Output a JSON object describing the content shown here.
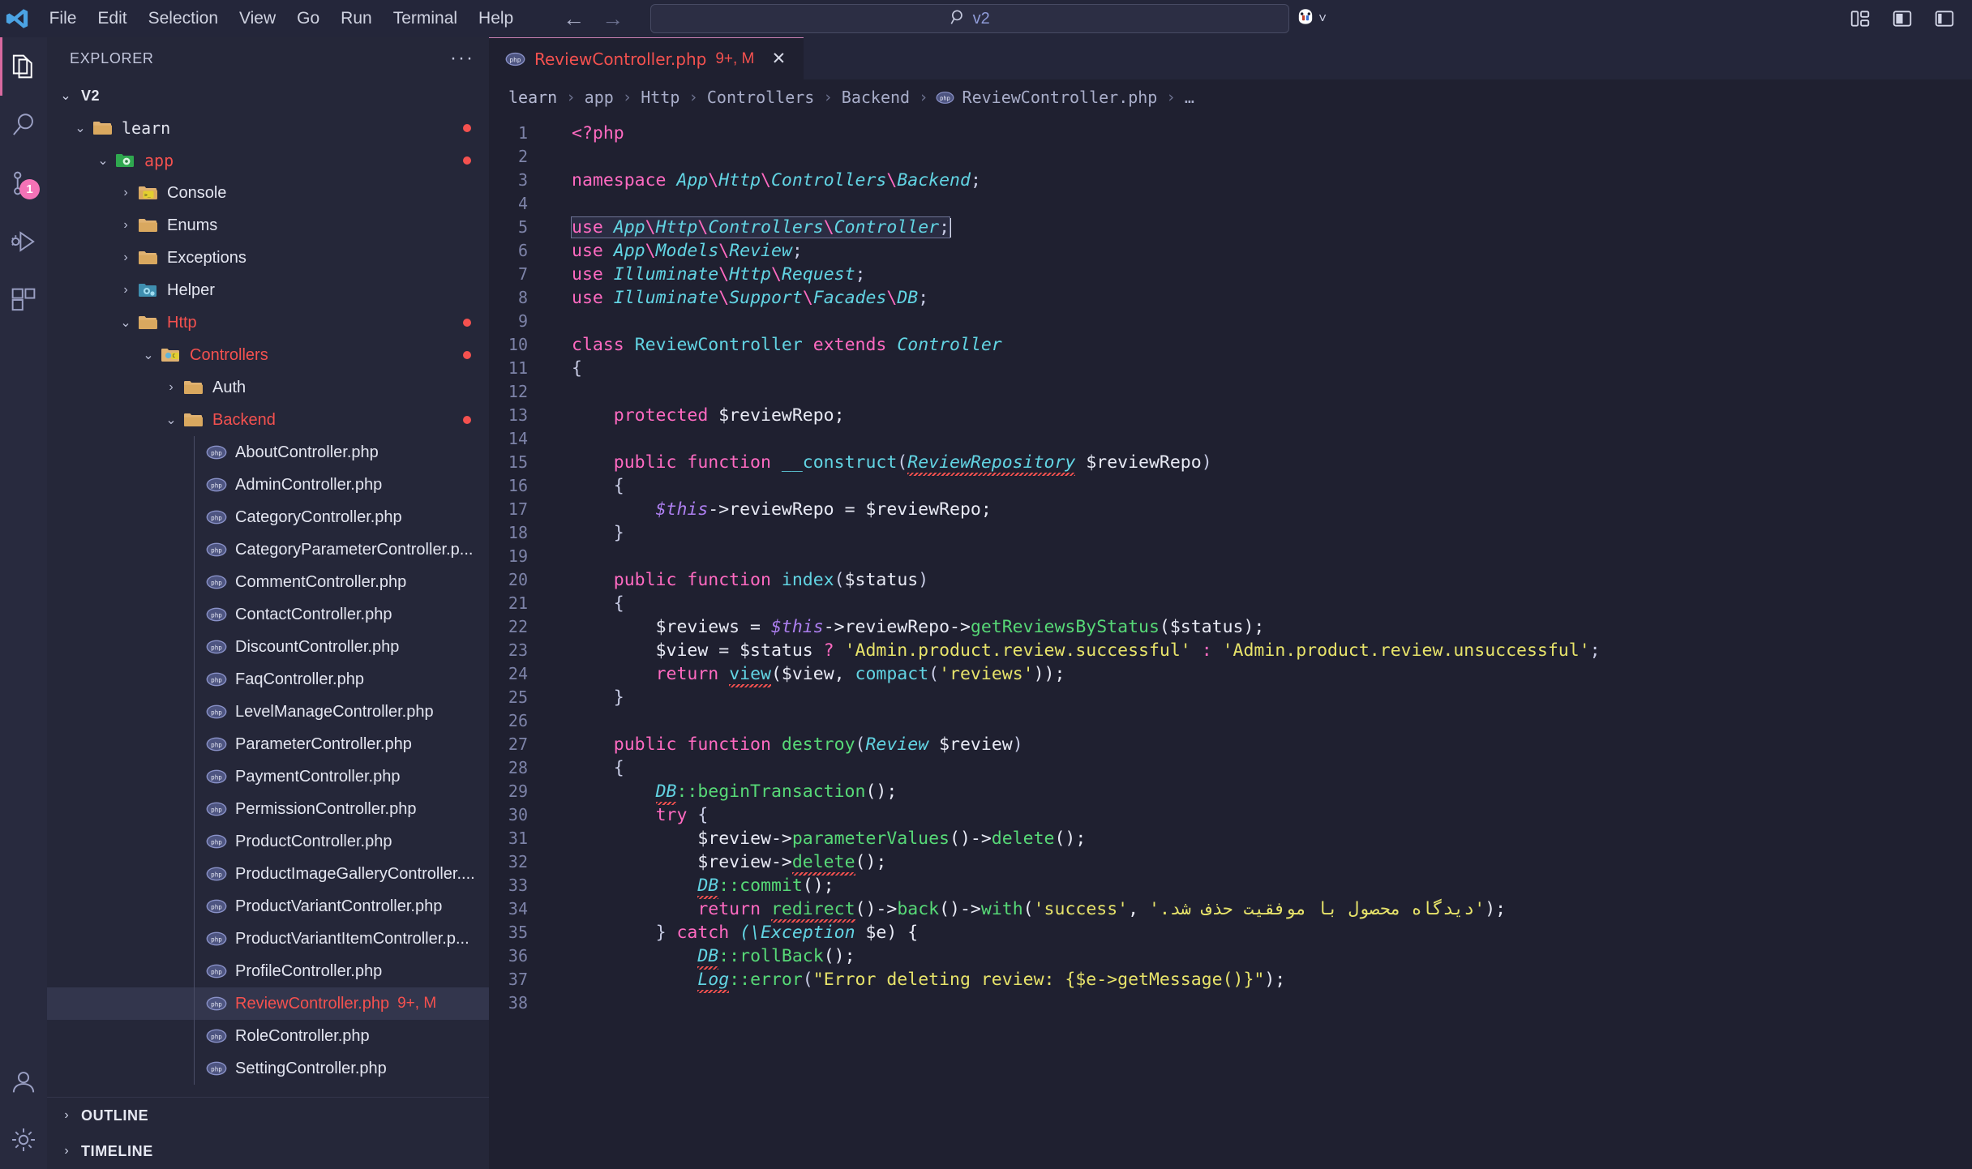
{
  "titlebar": {
    "logo_icon": "vscode-logo-icon",
    "menus": [
      "File",
      "Edit",
      "Selection",
      "View",
      "Go",
      "Run",
      "Terminal",
      "Help"
    ],
    "nav_back": "←",
    "nav_forward": "→",
    "quickinput": {
      "search_icon": "search-icon",
      "text": "v2",
      "placeholder": ""
    },
    "copilot_label": "copilot-icon",
    "chevron": "˅",
    "layout_icons": [
      "toggle-panel-icon",
      "toggle-secondary-sidebar-icon",
      "customize-layout-icon"
    ]
  },
  "activitybar": {
    "items": [
      {
        "name": "explorer",
        "icon": "files-icon",
        "active": true,
        "badge": ""
      },
      {
        "name": "search",
        "icon": "search-icon",
        "active": false,
        "badge": ""
      },
      {
        "name": "source-control",
        "icon": "source-control-icon",
        "active": false,
        "badge": "1"
      },
      {
        "name": "run-and-debug",
        "icon": "debug-icon",
        "active": false,
        "badge": ""
      },
      {
        "name": "extensions",
        "icon": "extensions-icon",
        "active": false,
        "badge": ""
      }
    ],
    "bottom": [
      {
        "name": "accounts",
        "icon": "account-icon"
      },
      {
        "name": "settings",
        "icon": "gear-icon"
      }
    ]
  },
  "sidebar": {
    "title": "EXPLORER",
    "more_actions": "···",
    "root": {
      "label": "V2",
      "expanded": true
    },
    "tree": [
      {
        "depth": 1,
        "label": "learn",
        "type": "folder",
        "icon": "folder-open-icon",
        "state": "expanded",
        "err": false,
        "dot": true,
        "mono": true
      },
      {
        "depth": 2,
        "label": "app",
        "type": "folder",
        "icon": "folder-app-icon",
        "state": "expanded",
        "err": true,
        "dot": true,
        "mono": true
      },
      {
        "depth": 3,
        "label": "Console",
        "type": "folder",
        "icon": "folder-console-icon",
        "state": "collapsed",
        "err": false,
        "dot": false,
        "mono": false
      },
      {
        "depth": 3,
        "label": "Enums",
        "type": "folder",
        "icon": "folder-icon",
        "state": "collapsed",
        "err": false,
        "dot": false,
        "mono": false
      },
      {
        "depth": 3,
        "label": "Exceptions",
        "type": "folder",
        "icon": "folder-icon",
        "state": "collapsed",
        "err": false,
        "dot": false,
        "mono": false
      },
      {
        "depth": 3,
        "label": "Helper",
        "type": "folder",
        "icon": "folder-helper-icon",
        "state": "collapsed",
        "err": false,
        "dot": false,
        "mono": false
      },
      {
        "depth": 3,
        "label": "Http",
        "type": "folder",
        "icon": "folder-icon",
        "state": "expanded",
        "err": true,
        "dot": true,
        "mono": false
      },
      {
        "depth": 4,
        "label": "Controllers",
        "type": "folder",
        "icon": "folder-controller-icon",
        "state": "expanded",
        "err": true,
        "dot": true,
        "mono": false
      },
      {
        "depth": 5,
        "label": "Auth",
        "type": "folder",
        "icon": "folder-icon",
        "state": "collapsed",
        "err": false,
        "dot": false,
        "mono": false
      },
      {
        "depth": 5,
        "label": "Backend",
        "type": "folder",
        "icon": "folder-icon",
        "state": "expanded",
        "err": true,
        "dot": true,
        "mono": false
      },
      {
        "depth": 6,
        "label": "AboutController.php",
        "type": "file",
        "icon": "php-icon",
        "state": "none",
        "err": false,
        "dot": false,
        "mono": false
      },
      {
        "depth": 6,
        "label": "AdminController.php",
        "type": "file",
        "icon": "php-icon",
        "state": "none",
        "err": false,
        "dot": false,
        "mono": false
      },
      {
        "depth": 6,
        "label": "CategoryController.php",
        "type": "file",
        "icon": "php-icon",
        "state": "none",
        "err": false,
        "dot": false,
        "mono": false
      },
      {
        "depth": 6,
        "label": "CategoryParameterController.p...",
        "type": "file",
        "icon": "php-icon",
        "state": "none",
        "err": false,
        "dot": false,
        "mono": false
      },
      {
        "depth": 6,
        "label": "CommentController.php",
        "type": "file",
        "icon": "php-icon",
        "state": "none",
        "err": false,
        "dot": false,
        "mono": false
      },
      {
        "depth": 6,
        "label": "ContactController.php",
        "type": "file",
        "icon": "php-icon",
        "state": "none",
        "err": false,
        "dot": false,
        "mono": false
      },
      {
        "depth": 6,
        "label": "DiscountController.php",
        "type": "file",
        "icon": "php-icon",
        "state": "none",
        "err": false,
        "dot": false,
        "mono": false
      },
      {
        "depth": 6,
        "label": "FaqController.php",
        "type": "file",
        "icon": "php-icon",
        "state": "none",
        "err": false,
        "dot": false,
        "mono": false
      },
      {
        "depth": 6,
        "label": "LevelManageController.php",
        "type": "file",
        "icon": "php-icon",
        "state": "none",
        "err": false,
        "dot": false,
        "mono": false
      },
      {
        "depth": 6,
        "label": "ParameterController.php",
        "type": "file",
        "icon": "php-icon",
        "state": "none",
        "err": false,
        "dot": false,
        "mono": false
      },
      {
        "depth": 6,
        "label": "PaymentController.php",
        "type": "file",
        "icon": "php-icon",
        "state": "none",
        "err": false,
        "dot": false,
        "mono": false
      },
      {
        "depth": 6,
        "label": "PermissionController.php",
        "type": "file",
        "icon": "php-icon",
        "state": "none",
        "err": false,
        "dot": false,
        "mono": false
      },
      {
        "depth": 6,
        "label": "ProductController.php",
        "type": "file",
        "icon": "php-icon",
        "state": "none",
        "err": false,
        "dot": false,
        "mono": false
      },
      {
        "depth": 6,
        "label": "ProductImageGalleryController....",
        "type": "file",
        "icon": "php-icon",
        "state": "none",
        "err": false,
        "dot": false,
        "mono": false
      },
      {
        "depth": 6,
        "label": "ProductVariantController.php",
        "type": "file",
        "icon": "php-icon",
        "state": "none",
        "err": false,
        "dot": false,
        "mono": false
      },
      {
        "depth": 6,
        "label": "ProductVariantItemController.p...",
        "type": "file",
        "icon": "php-icon",
        "state": "none",
        "err": false,
        "dot": false,
        "mono": false
      },
      {
        "depth": 6,
        "label": "ProfileController.php",
        "type": "file",
        "icon": "php-icon",
        "state": "none",
        "err": false,
        "dot": false,
        "mono": false
      },
      {
        "depth": 6,
        "label": "ReviewController.php",
        "type": "file",
        "icon": "php-icon",
        "state": "none",
        "err": true,
        "dot": false,
        "mono": false,
        "selected": true,
        "badge": "9+, M"
      },
      {
        "depth": 6,
        "label": "RoleController.php",
        "type": "file",
        "icon": "php-icon",
        "state": "none",
        "err": false,
        "dot": false,
        "mono": false
      },
      {
        "depth": 6,
        "label": "SettingController.php",
        "type": "file",
        "icon": "php-icon",
        "state": "none",
        "err": false,
        "dot": false,
        "mono": false
      }
    ],
    "outline": "OUTLINE",
    "timeline": "TIMELINE"
  },
  "editor": {
    "tab": {
      "icon": "php-icon",
      "name": "ReviewController.php",
      "badge": "9+, M",
      "close": "✕"
    },
    "breadcrumb": [
      "learn",
      "app",
      "Http",
      "Controllers",
      "Backend",
      "ReviewController.php",
      "…"
    ],
    "breadcrumb_file_icon": "php-icon",
    "separator": "›",
    "code_lines": [
      {
        "n": 1,
        "guide": false
      },
      {
        "n": 2,
        "guide": false
      },
      {
        "n": 3,
        "guide": false
      },
      {
        "n": 4,
        "guide": false
      },
      {
        "n": 5,
        "guide": false
      },
      {
        "n": 6,
        "guide": false
      },
      {
        "n": 7,
        "guide": false
      },
      {
        "n": 8,
        "guide": false
      },
      {
        "n": 9,
        "guide": false
      },
      {
        "n": 10,
        "guide": false
      },
      {
        "n": 11,
        "guide": false
      },
      {
        "n": 12,
        "guide": true
      },
      {
        "n": 13,
        "guide": true
      },
      {
        "n": 14,
        "guide": true
      },
      {
        "n": 15,
        "guide": true
      },
      {
        "n": 16,
        "guide": false
      },
      {
        "n": 17,
        "guide": true
      },
      {
        "n": 18,
        "guide": false
      },
      {
        "n": 19,
        "guide": false
      },
      {
        "n": 20,
        "guide": false
      },
      {
        "n": 21,
        "guide": false
      },
      {
        "n": 22,
        "guide": true
      },
      {
        "n": 23,
        "guide": true
      },
      {
        "n": 24,
        "guide": true
      },
      {
        "n": 25,
        "guide": false
      },
      {
        "n": 26,
        "guide": false
      },
      {
        "n": 27,
        "guide": false
      },
      {
        "n": 28,
        "guide": false
      },
      {
        "n": 29,
        "guide": false
      },
      {
        "n": 30,
        "guide": false
      },
      {
        "n": 31,
        "guide": false
      },
      {
        "n": 32,
        "guide": false
      },
      {
        "n": 33,
        "guide": false
      },
      {
        "n": 34,
        "guide": true
      },
      {
        "n": 35,
        "guide": false
      },
      {
        "n": 36,
        "guide": false
      },
      {
        "n": 37,
        "guide": true
      },
      {
        "n": 38,
        "guide": true
      }
    ],
    "code_text": {
      "l1": "<?php",
      "l3_kw": "namespace",
      "l3_ns": "App\\Http\\Controllers\\Backend",
      "l5_kw": "use",
      "l5_ns": "App\\Http\\Controllers\\Controller",
      "l6_kw": "use",
      "l6_ns": "App\\Models\\Review",
      "l7_kw": "use",
      "l7_ns": "Illuminate\\Http\\Request",
      "l8_kw": "use",
      "l8_ns": "Illuminate\\Support\\Facades\\DB",
      "l10_class": "class",
      "l10_name": "ReviewController",
      "l10_extends": "extends",
      "l10_parent": "Controller",
      "l11": "{",
      "l13_kw": "protected",
      "l13_var": "$reviewRepo;",
      "l15_kw": "public function",
      "l15_fn": "__construct",
      "l15_type": "ReviewRepository",
      "l15_arg": "$reviewRepo",
      "l16": "{",
      "l17_this": "$this",
      "l17_rest": "->reviewRepo = $reviewRepo;",
      "l18": "}",
      "l20_kw": "public function",
      "l20_fn": "index",
      "l20_arg": "$status",
      "l21": "{",
      "l22_var": "$reviews = ",
      "l22_this": "$this",
      "l22_mid": "->reviewRepo->",
      "l22_mth": "getReviewsByStatus",
      "l22_end": "($status);",
      "l23_a": "$view = $status ",
      "l23_q": "?",
      "l23_s1": "'Admin.product.review.successful'",
      "l23_c": ":",
      "l23_s2": "'Admin.product.review.unsuccessful'",
      "l23_end": ";",
      "l24_kw": "return",
      "l24_fn1": "view",
      "l24_mid": "($view, ",
      "l24_fn2": "compact",
      "l24_str": "'reviews'",
      "l24_end": "));",
      "l25": "}",
      "l27_kw": "public function",
      "l27_fn": "destroy",
      "l27_type": "Review",
      "l27_arg": "$review",
      "l28": "{",
      "l29_db": "DB",
      "l29_mth": "::beginTransaction",
      "l29_end": "();",
      "l30_kw": "try",
      "l30_brace": "{",
      "l31_var": "$review->",
      "l31_m1": "parameterValues",
      "l31_mid": "()->",
      "l31_m2": "delete",
      "l31_end": "();",
      "l32_var": "$review->",
      "l32_m": "delete",
      "l32_end": "();",
      "l33_db": "DB",
      "l33_mth": "::commit",
      "l33_end": "();",
      "l34_kw": "return",
      "l34_f1": "redirect",
      "l34_a1": "()->",
      "l34_f2": "back",
      "l34_a2": "()->",
      "l34_f3": "with",
      "l34_p1": "(",
      "l34_s1": "'success'",
      "l34_comma": ", ",
      "l34_s2": "'دیدگاه محصول با موفقیت حذف شد.'",
      "l34_end": ");",
      "l35_brace": "}",
      "l35_kw": "catch",
      "l35_type": "(\\Exception",
      "l35_arg": " $e) {",
      "l36_db": "DB",
      "l36_mth": "::rollBack",
      "l36_end": "();",
      "l37_log": "Log",
      "l37_mth": "::error",
      "l37_str": "\"Error deleting review: {$e->getMessage()}\"",
      "l37_end": ");"
    }
  }
}
